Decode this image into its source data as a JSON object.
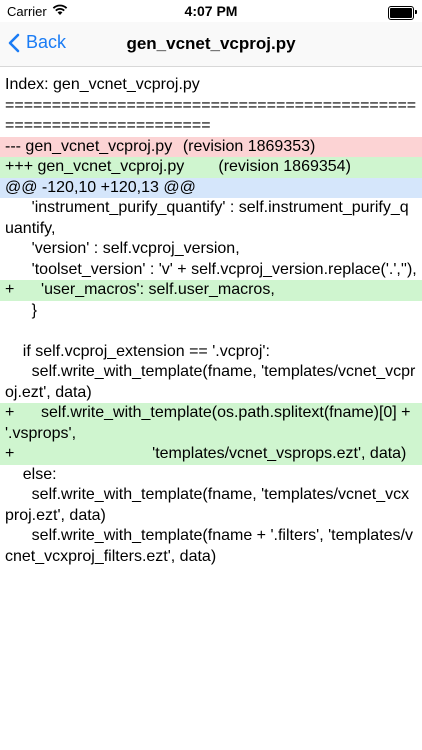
{
  "status_bar": {
    "carrier": "Carrier",
    "time": "4:07 PM"
  },
  "nav": {
    "back_label": "Back",
    "title": "gen_vcnet_vcproj.py"
  },
  "colors": {
    "accent": "#1a7cf5",
    "removed_bg": "#fcd3d4",
    "added_bg": "#cff5cf",
    "hunk_bg": "#d5e6fb"
  },
  "diff": {
    "lines": [
      {
        "type": "plain",
        "text": "Index: gen_vcnet_vcproj.py"
      },
      {
        "type": "plain",
        "text": "=================================================================="
      },
      {
        "type": "del",
        "text": "--- gen_vcnet_vcproj.py\t(revision 1869353)"
      },
      {
        "type": "add",
        "text": "+++ gen_vcnet_vcproj.py\t(revision 1869354)"
      },
      {
        "type": "hunk",
        "text": "@@ -120,10 +120,13 @@"
      },
      {
        "type": "plain",
        "text": "      'instrument_purify_quantify' : self.instrument_purify_quantify,"
      },
      {
        "type": "plain",
        "text": "      'version' : self.vcproj_version,"
      },
      {
        "type": "plain",
        "text": "      'toolset_version' : 'v' + self.vcproj_version.replace('.',''),"
      },
      {
        "type": "add",
        "text": "+      'user_macros': self.user_macros,"
      },
      {
        "type": "plain",
        "text": "      }"
      },
      {
        "type": "plain",
        "text": " "
      },
      {
        "type": "plain",
        "text": "    if self.vcproj_extension == '.vcproj':"
      },
      {
        "type": "plain",
        "text": "      self.write_with_template(fname, 'templates/vcnet_vcproj.ezt', data)"
      },
      {
        "type": "add",
        "text": "+      self.write_with_template(os.path.splitext(fname)[0] + '.vsprops',"
      },
      {
        "type": "add",
        "text": "+                               'templates/vcnet_vsprops.ezt', data)"
      },
      {
        "type": "plain",
        "text": "    else:"
      },
      {
        "type": "plain",
        "text": "      self.write_with_template(fname, 'templates/vcnet_vcxproj.ezt', data)"
      },
      {
        "type": "plain",
        "text": "      self.write_with_template(fname + '.filters', 'templates/vcnet_vcxproj_filters.ezt', data)"
      }
    ]
  }
}
